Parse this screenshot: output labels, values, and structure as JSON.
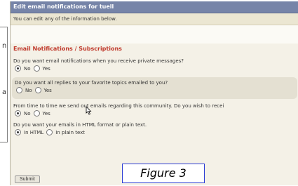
{
  "margin": {
    "letter_top": "n",
    "letter_mid": "a"
  },
  "window": {
    "title": "Edit email notifications for tuell",
    "subtitle": "You can edit any of the information below."
  },
  "section": {
    "title": "Email Notifications / Subscriptions",
    "questions": [
      {
        "text": "Do you want email notifications when you receive private messages?",
        "options": [
          "No",
          "Yes"
        ],
        "selected": 0
      },
      {
        "text": "Do you want all replies to your favorite topics emailed to you?",
        "options": [
          "No",
          "Yes"
        ],
        "selected": null
      },
      {
        "text": "From time to time we send out emails regarding this community. Do you wish to recei",
        "options": [
          "No",
          "Yes"
        ],
        "selected": 0
      },
      {
        "text": "Do you want your emails in HTML format or plain text.",
        "options": [
          "In HTML",
          "In plain text"
        ],
        "selected": 0
      }
    ]
  },
  "submit_label": "Submit",
  "figure_label": "Figure 3",
  "colors": {
    "titlebar": "#7684a8",
    "section_title": "#c0392b",
    "figure_border": "#2a3bd4"
  }
}
